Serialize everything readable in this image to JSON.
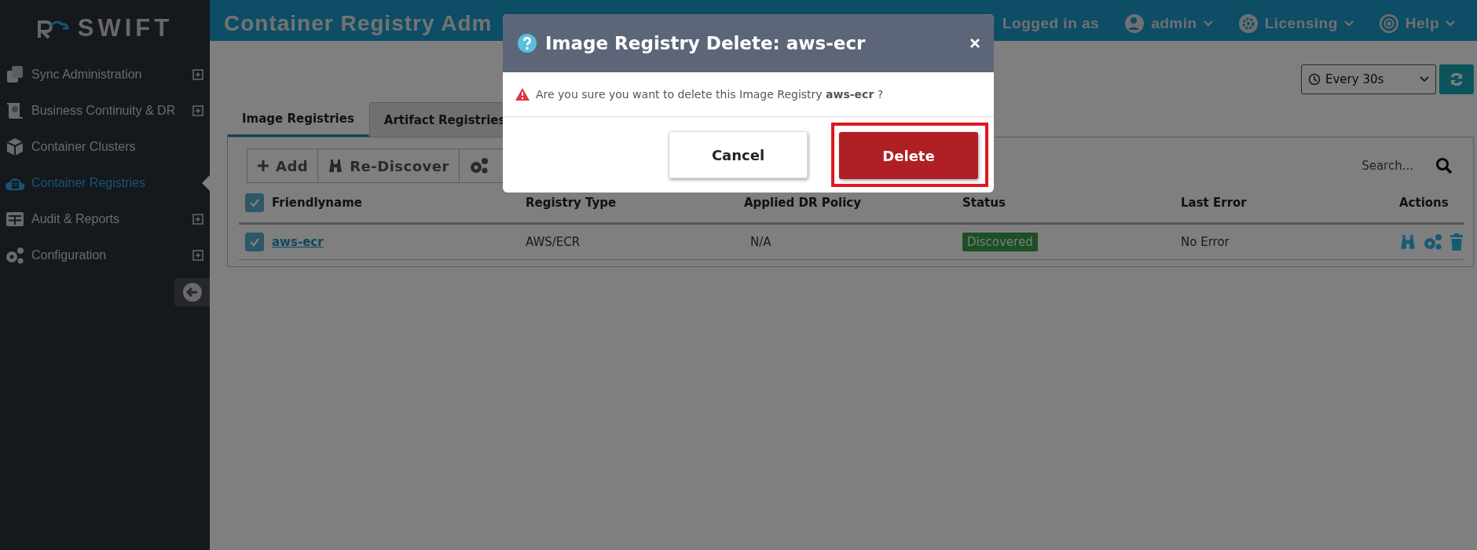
{
  "logo": {
    "text": "SWIFT"
  },
  "sidebar": {
    "items": [
      {
        "label": "Sync Administration",
        "expandable": true,
        "selected": false
      },
      {
        "label": "Business Continuity & DR",
        "expandable": true,
        "selected": false
      },
      {
        "label": "Container Clusters",
        "expandable": false,
        "selected": false
      },
      {
        "label": "Container Registries",
        "expandable": false,
        "selected": true
      },
      {
        "label": "Audit & Reports",
        "expandable": true,
        "selected": false
      },
      {
        "label": "Configuration",
        "expandable": true,
        "selected": false
      }
    ]
  },
  "header": {
    "title": "Container Registry Adm",
    "logged_in_label": "Logged in as",
    "user": "admin",
    "menus": [
      "Licensing",
      "Help"
    ]
  },
  "refresh": {
    "value": "Every 30s"
  },
  "tabs": [
    {
      "label": "Image Registries",
      "selected": true
    },
    {
      "label": "Artifact Registries",
      "selected": false
    }
  ],
  "toolbar": [
    "Add",
    "Re-Discover"
  ],
  "search": {
    "placeholder": "Search..."
  },
  "table": {
    "header_checked": true,
    "columns": [
      "Friendlyname",
      "Registry Type",
      "Applied DR Policy",
      "Status",
      "Last Error",
      "Actions"
    ],
    "rows": [
      {
        "checked": true,
        "friendlyname": "aws-ecr",
        "registry_type": "AWS/ECR",
        "applied_dr_policy": "N/A",
        "status": "Discovered",
        "last_error": "No Error"
      }
    ]
  },
  "modal": {
    "title": "Image Registry Delete: aws-ecr",
    "message": "Are you sure you want to delete this Image Registry **aws-ecr** ?",
    "buttons": [
      {
        "label": "Cancel",
        "kind": "default",
        "highlighted": false
      },
      {
        "label": "Delete",
        "kind": "danger",
        "highlighted": true
      }
    ]
  }
}
